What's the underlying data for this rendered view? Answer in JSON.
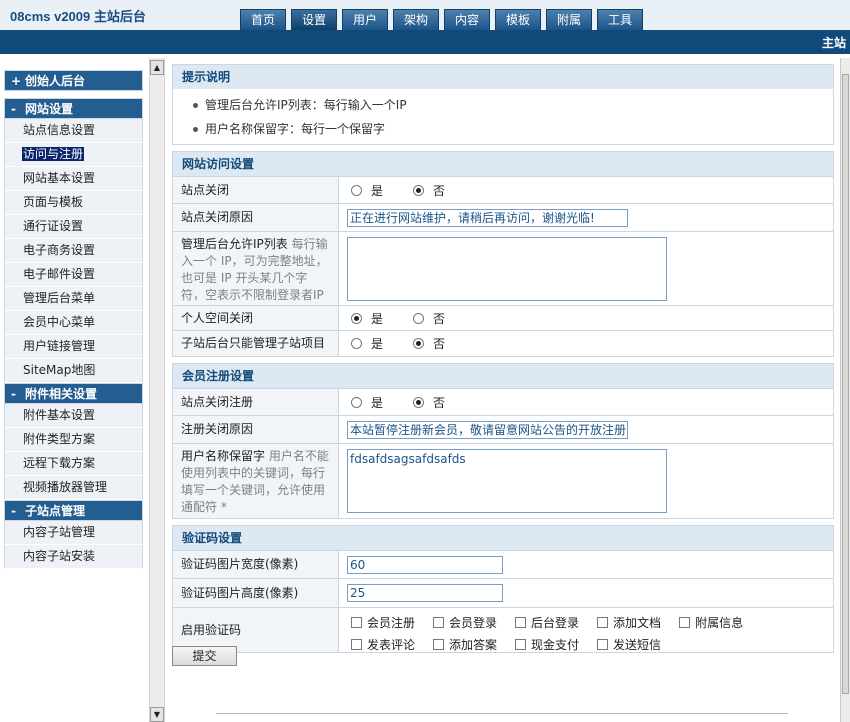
{
  "header": {
    "brand": "08cms v2009 主站后台",
    "tabs": [
      "首页",
      "设置",
      "用户",
      "架构",
      "内容",
      "模板",
      "附属",
      "工具"
    ],
    "active_tab": "设置",
    "right_label": "主站"
  },
  "sidebar": {
    "groups": [
      {
        "sign": "+",
        "title": "创始人后台",
        "items": []
      },
      {
        "sign": "-",
        "title": "网站设置",
        "items": [
          "站点信息设置",
          "访问与注册",
          "网站基本设置",
          "页面与模板",
          "通行证设置",
          "电子商务设置",
          "电子邮件设置",
          "管理后台菜单",
          "会员中心菜单",
          "用户链接管理",
          "SiteMap地图"
        ]
      },
      {
        "sign": "-",
        "title": "附件相关设置",
        "items": [
          "附件基本设置",
          "附件类型方案",
          "远程下载方案",
          "视频播放器管理"
        ]
      },
      {
        "sign": "-",
        "title": "子站点管理",
        "items": [
          "内容子站管理",
          "内容子站安装"
        ]
      }
    ],
    "selected_item": "访问与注册"
  },
  "scrollbar": {
    "up_arrow": "▲",
    "down_arrow": "▼"
  },
  "tips": {
    "title": "提示说明",
    "items": [
      "管理后台允许IP列表：每行输入一个IP",
      "用户名称保留字：每行一个保留字"
    ]
  },
  "access": {
    "title": "网站访问设置",
    "site_closed": {
      "label": "站点关闭",
      "yes": "是",
      "no": "否",
      "value": "否"
    },
    "close_reason": {
      "label": "站点关闭原因",
      "value": "正在进行网站维护，请稍后再访问，谢谢光临!"
    },
    "ip_list": {
      "label": "管理后台允许IP列表",
      "hint": "每行输入一个 IP，可为完整地址，也可是 IP 开头某几个字符，空表示不限制登录者IP",
      "value": ""
    },
    "space_closed": {
      "label": "个人空间关闭",
      "yes": "是",
      "no": "否",
      "value": "是"
    },
    "subsite_only": {
      "label": "子站后台只能管理子站项目",
      "yes": "是",
      "no": "否",
      "value": "否"
    }
  },
  "register": {
    "title": "会员注册设置",
    "reg_closed": {
      "label": "站点关闭注册",
      "yes": "是",
      "no": "否",
      "value": "否"
    },
    "reg_reason": {
      "label": "注册关闭原因",
      "value": "本站暂停注册新会员，敬请留意网站公告的开放注册"
    },
    "reserved": {
      "label": "用户名称保留字",
      "hint": "用户名不能使用列表中的关键词，每行填写一个关键词，允许使用通配符 *",
      "value": "fdsafdsagsafdsafds"
    }
  },
  "captcha": {
    "title": "验证码设置",
    "width": {
      "label": "验证码图片宽度(像素)",
      "value": "60"
    },
    "height": {
      "label": "验证码图片高度(像素)",
      "value": "25"
    },
    "enable": {
      "label": "启用验证码",
      "options": [
        "会员注册",
        "会员登录",
        "后台登录",
        "添加文档",
        "附属信息",
        "发表评论",
        "添加答案",
        "现金支付",
        "发送短信"
      ],
      "checked": []
    }
  },
  "submit_label": "提交"
}
